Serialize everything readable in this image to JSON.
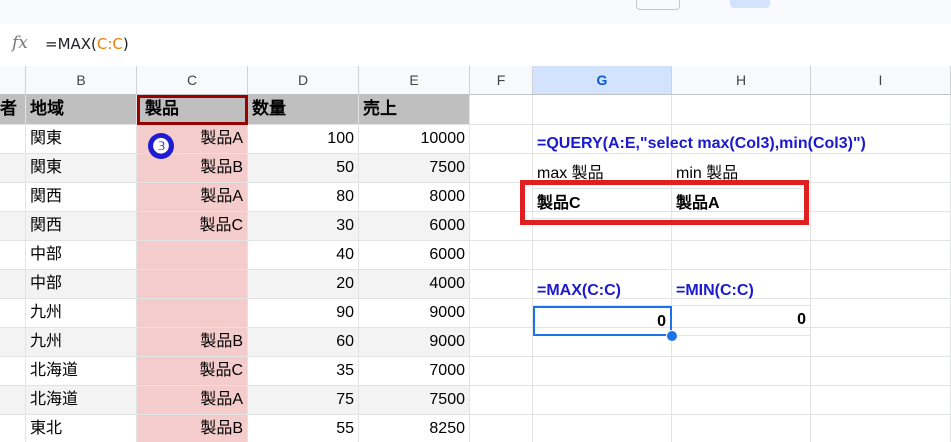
{
  "formula_bar": {
    "fx_icon": "fx-icon",
    "formula_prefix": "=MAX(",
    "formula_ref": "C:C",
    "formula_suffix": ")"
  },
  "columns": [
    "B",
    "C",
    "D",
    "E",
    "F",
    "G",
    "H",
    "I"
  ],
  "selected_column": "G",
  "header_row": {
    "a": "者",
    "b": "地域",
    "c": "製品",
    "d": "数量",
    "e": "売上"
  },
  "rows": [
    {
      "b": "関東",
      "c": "製品A",
      "d": "100",
      "e": "10000"
    },
    {
      "b": "関東",
      "c": "製品B",
      "d": "50",
      "e": "7500"
    },
    {
      "b": "関西",
      "c": "製品A",
      "d": "80",
      "e": "8000"
    },
    {
      "b": "関西",
      "c": "製品C",
      "d": "30",
      "e": "6000"
    },
    {
      "b": "中部",
      "c": "",
      "d": "40",
      "e": "6000"
    },
    {
      "b": "中部",
      "c": "",
      "d": "20",
      "e": "4000"
    },
    {
      "b": "九州",
      "c": "",
      "d": "90",
      "e": "9000"
    },
    {
      "b": "九州",
      "c": "製品B",
      "d": "60",
      "e": "9000"
    },
    {
      "b": "北海道",
      "c": "製品C",
      "d": "35",
      "e": "7000"
    },
    {
      "b": "北海道",
      "c": "製品A",
      "d": "75",
      "e": "7500"
    },
    {
      "b": "東北",
      "c": "製品B",
      "d": "55",
      "e": "8250"
    }
  ],
  "annotation_badge": "❸",
  "query_formula": "=QUERY(A:E,\"select max(Col3),min(Col3)\")",
  "query_header": {
    "g": "max 製品",
    "h": "min 製品"
  },
  "query_result": {
    "g": "製品C",
    "h": "製品A"
  },
  "max_label": "=MAX(C:C)",
  "min_label": "=MIN(C:C)",
  "max_value": "0",
  "min_value": "0",
  "colors": {
    "highlight": "#f4cccc",
    "header_gray": "#bfbfbf",
    "formula_blue": "#1a1acf",
    "callout_red": "#e02020",
    "selection": "#1a73e8"
  }
}
